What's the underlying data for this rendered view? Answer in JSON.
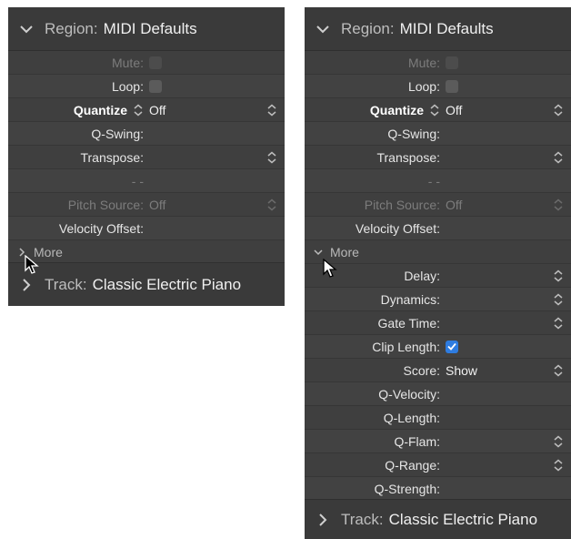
{
  "left": {
    "header": {
      "prefix": "Region:",
      "title": "MIDI Defaults"
    },
    "rows": [
      {
        "label": "Mute:",
        "value": "",
        "dim": true
      },
      {
        "label": "Loop:",
        "value": ""
      },
      {
        "label": "Quantize",
        "value": "Off"
      },
      {
        "label": "Q-Swing:",
        "value": ""
      },
      {
        "label": "Transpose:",
        "value": ""
      },
      {
        "label": "- -",
        "value": ""
      },
      {
        "label": "Pitch Source:",
        "value": "Off"
      },
      {
        "label": "Velocity Offset:",
        "value": ""
      }
    ],
    "more_label": "More",
    "track": {
      "prefix": "Track:",
      "title": "Classic Electric Piano"
    }
  },
  "right": {
    "header": {
      "prefix": "Region:",
      "title": "MIDI Defaults"
    },
    "rows": [
      {
        "label": "Mute:",
        "value": ""
      },
      {
        "label": "Loop:",
        "value": ""
      },
      {
        "label": "Quantize",
        "value": "Off"
      },
      {
        "label": "Q-Swing:",
        "value": ""
      },
      {
        "label": "Transpose:",
        "value": ""
      },
      {
        "label": "- -",
        "value": ""
      },
      {
        "label": "Pitch Source:",
        "value": "Off"
      },
      {
        "label": "Velocity Offset:",
        "value": ""
      }
    ],
    "more_label": "More",
    "more_rows": [
      {
        "label": "Delay:",
        "value": ""
      },
      {
        "label": "Dynamics:",
        "value": ""
      },
      {
        "label": "Gate Time:",
        "value": ""
      },
      {
        "label": "Clip Length:",
        "value": "",
        "checked": true
      },
      {
        "label": "Score:",
        "value": "Show"
      },
      {
        "label": "Q-Velocity:",
        "value": ""
      },
      {
        "label": "Q-Length:",
        "value": ""
      },
      {
        "label": "Q-Flam:",
        "value": ""
      },
      {
        "label": "Q-Range:",
        "value": ""
      },
      {
        "label": "Q-Strength:",
        "value": ""
      }
    ],
    "track": {
      "prefix": "Track:",
      "title": "Classic Electric Piano"
    }
  },
  "icons": {
    "header_chevron": "chevron-down-icon",
    "track_chevron": "chevron-right-icon",
    "stepper": "up-down-stepper-icon",
    "checkbox": "checkbox-icon",
    "cursor": "mouse-pointer-icon"
  },
  "colors": {
    "panel_bg": "#3f3f3f",
    "checkbox_checked": "#2e7ce0"
  }
}
